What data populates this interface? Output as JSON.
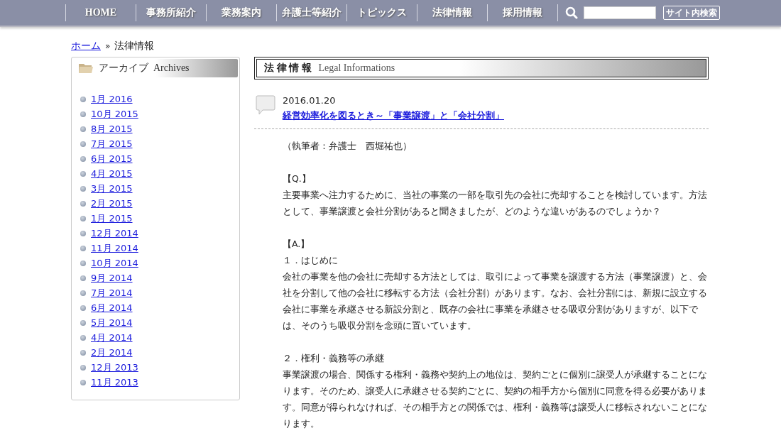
{
  "nav": {
    "items": [
      "HOME",
      "事務所紹介",
      "業務案内",
      "弁護士等紹介",
      "トピックス",
      "法律情報",
      "採用情報"
    ],
    "search_button": "サイト内検索"
  },
  "breadcrumb": {
    "home": "ホーム",
    "separator": "»",
    "current": "法律情報"
  },
  "sidebar": {
    "title": "アーカイブ  Archives",
    "links": [
      "1月 2016",
      "10月 2015",
      "8月 2015",
      "7月 2015",
      "6月 2015",
      "4月 2015",
      "3月 2015",
      "2月 2015",
      "1月 2015",
      "12月 2014",
      "11月 2014",
      "10月 2014",
      "9月 2014",
      "7月 2014",
      "6月 2014",
      "5月 2014",
      "4月 2014",
      "2月 2014",
      "12月 2013",
      "11月 2013"
    ]
  },
  "section": {
    "title": "法 律 情 報",
    "subtitle": "Legal Informations"
  },
  "post": {
    "date": "2016.01.20",
    "title": "経営効率化を図るとき～「事業譲渡」と「会社分割」",
    "sections": [
      [
        "（執筆者：弁護士　西堀祐也）"
      ],
      [
        "【Q.】",
        "主要事業へ注力するために、当社の事業の一部を取引先の会社に売却することを検討しています。方法として、事業譲渡と会社分割があると聞きましたが、どのような違いがあるのでしょうか？"
      ],
      [
        "【A.】",
        "１．はじめに",
        "会社の事業を他の会社に売却する方法としては、取引によって事業を譲渡する方法（事業譲渡）と、会社を分割して他の会社に移転する方法（会社分割）があります。なお、会社分割には、新規に設立する会社に事業を承継させる新設分割と、既存の会社に事業を承継させる吸収分割がありますが、以下では、そのうち吸収分割を念頭に置いています。"
      ],
      [
        "２．権利・義務等の承継",
        "事業譲渡の場合、関係する権利・義務や契約上の地位は、契約ごとに個別に譲受人が承継することになります。そのため、譲受人に承継させる契約ごとに、契約の相手方から個別に同意を得る必要があります。同意が得られなければ、その相手方との関係では、権利・義務等は譲受人に移転されないことになります。"
      ]
    ]
  }
}
